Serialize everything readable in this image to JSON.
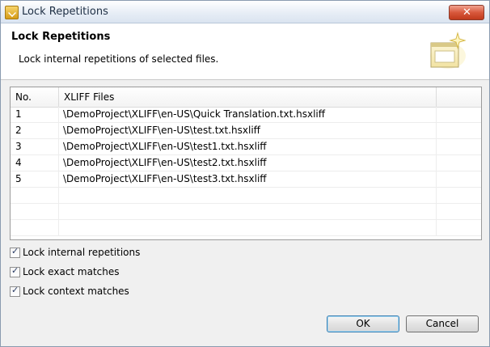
{
  "window": {
    "title": "Lock Repetitions",
    "close_glyph": "✕"
  },
  "banner": {
    "title": "Lock Repetitions",
    "description": "Lock internal repetitions of selected files."
  },
  "table": {
    "headers": {
      "no": "No.",
      "files": "XLIFF Files"
    },
    "rows": [
      {
        "no": "1",
        "file": "\\DemoProject\\XLIFF\\en-US\\Quick Translation.txt.hsxliff"
      },
      {
        "no": "2",
        "file": "\\DemoProject\\XLIFF\\en-US\\test.txt.hsxliff"
      },
      {
        "no": "3",
        "file": "\\DemoProject\\XLIFF\\en-US\\test1.txt.hsxliff"
      },
      {
        "no": "4",
        "file": "\\DemoProject\\XLIFF\\en-US\\test2.txt.hsxliff"
      },
      {
        "no": "5",
        "file": "\\DemoProject\\XLIFF\\en-US\\test3.txt.hsxliff"
      },
      {
        "no": "",
        "file": ""
      },
      {
        "no": "",
        "file": ""
      },
      {
        "no": "",
        "file": ""
      }
    ]
  },
  "options": [
    {
      "label": "Lock internal repetitions",
      "checked": true
    },
    {
      "label": "Lock exact matches",
      "checked": true
    },
    {
      "label": "Lock context matches",
      "checked": true
    }
  ],
  "buttons": {
    "ok": "OK",
    "cancel": "Cancel"
  },
  "colors": {
    "accent": "#3c7fb1",
    "close": "#c03a1c"
  }
}
